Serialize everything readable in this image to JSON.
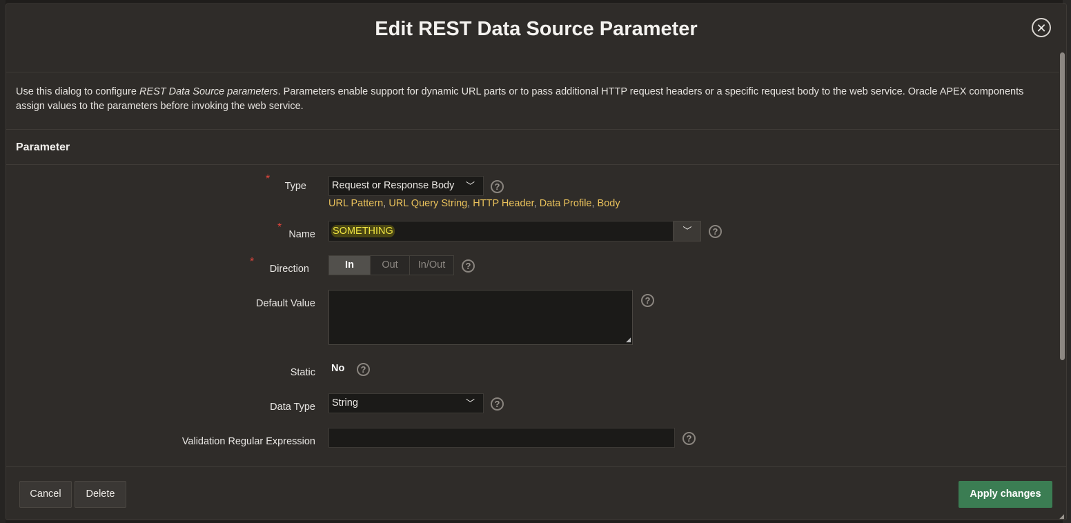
{
  "dialog": {
    "title": "Edit REST Data Source Parameter",
    "close_label": "✕"
  },
  "help": {
    "before": "Use this dialog to configure ",
    "emphasis": "REST Data Source parameters",
    "after": ". Parameters enable support for dynamic URL parts or to pass additional HTTP request headers or a specific request body to the web service. Oracle APEX components assign values to the parameters before invoking the web service."
  },
  "section": {
    "title": "Parameter"
  },
  "fields": {
    "type": {
      "label": "Type",
      "value": "Request or Response Body",
      "links": [
        "URL Pattern",
        "URL Query String",
        "HTTP Header",
        "Data Profile",
        "Body"
      ]
    },
    "name": {
      "label": "Name",
      "value": "SOMETHING"
    },
    "direction": {
      "label": "Direction",
      "options": [
        "In",
        "Out",
        "In/Out"
      ],
      "selected": "In"
    },
    "default_value": {
      "label": "Default Value",
      "value": ""
    },
    "static": {
      "label": "Static",
      "value": "No"
    },
    "data_type": {
      "label": "Data Type",
      "value": "String"
    },
    "regex": {
      "label": "Validation Regular Expression",
      "value": ""
    }
  },
  "footer": {
    "cancel_label": "Cancel",
    "delete_label": "Delete",
    "apply_label": "Apply changes"
  },
  "icons": {
    "help": "?",
    "chevron": "﹀",
    "required": "*"
  },
  "colors": {
    "primary_button": "#3b7d53",
    "link": "#e9c15b",
    "required": "#e0453c",
    "highlight_text": "#f1e642"
  }
}
